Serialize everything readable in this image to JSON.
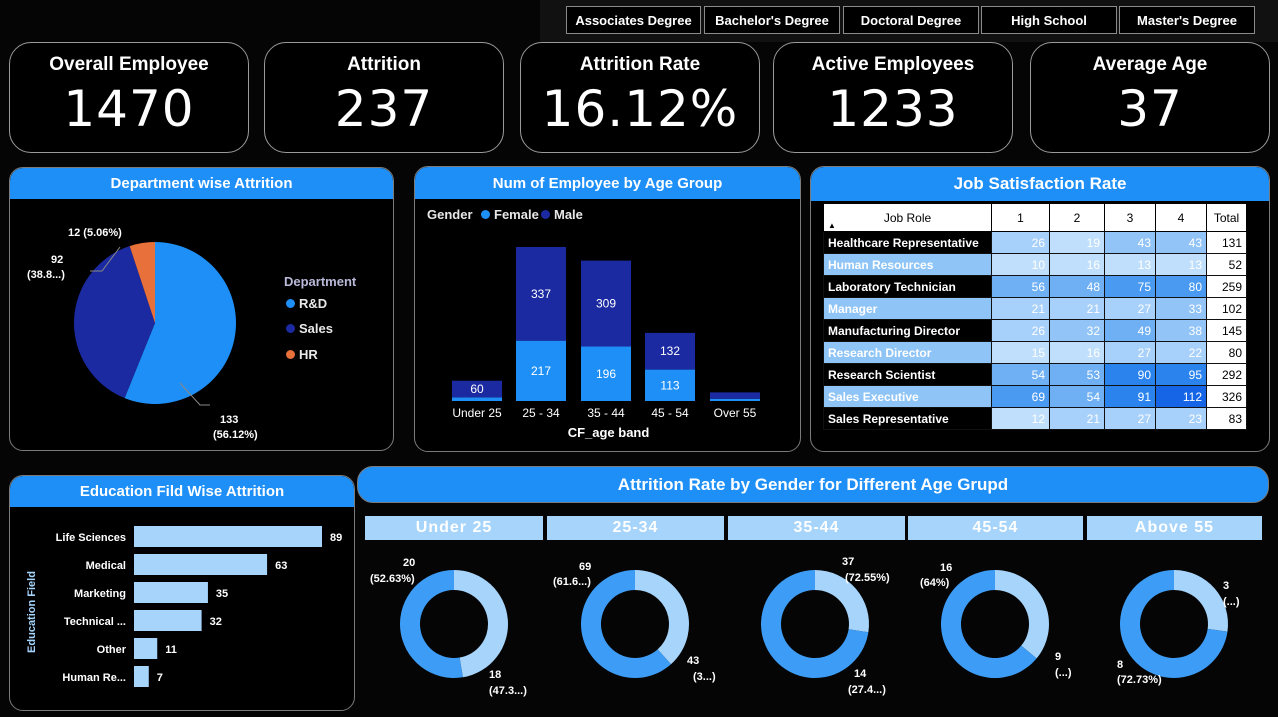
{
  "slicer": [
    "Associates Degree",
    "Bachelor's Degree",
    "Doctoral Degree",
    "High School",
    "Master's Degree"
  ],
  "kpis": [
    {
      "label": "Overall Employee",
      "value": "1470"
    },
    {
      "label": "Attrition",
      "value": "237"
    },
    {
      "label": "Attrition Rate",
      "value": "16.12%"
    },
    {
      "label": "Active Employees",
      "value": "1233"
    },
    {
      "label": "Average Age",
      "value": "37"
    }
  ],
  "colors": {
    "accent": "#1e8ff7",
    "rnd": "#1e8ff7",
    "sales": "#1b2aa0",
    "hr": "#e8703a",
    "light": "#a6d4fb"
  },
  "dept": {
    "title": "Department wise Attrition",
    "legend_title": "Department",
    "legend": [
      "R&D",
      "Sales",
      "HR"
    ],
    "labels": {
      "rnd_value": "133",
      "rnd_pct": "(56.12%)",
      "sales_value": "92",
      "sales_pct": "(38.8...)",
      "hr": "12 (5.06%)"
    }
  },
  "age": {
    "title": "Num of Employee by Age Group",
    "legend_title": "Gender",
    "legend": [
      "Female",
      "Male"
    ],
    "xlabel": "CF_age band"
  },
  "job": {
    "title": "Job Satisfaction Rate",
    "headers": [
      "Job Role",
      "1",
      "2",
      "3",
      "4",
      "Total"
    ],
    "rows": [
      {
        "role": "Healthcare Representative",
        "v": [
          "26",
          "19",
          "43",
          "43"
        ],
        "total": "131"
      },
      {
        "role": "Human Resources",
        "v": [
          "10",
          "16",
          "13",
          "13"
        ],
        "total": "52"
      },
      {
        "role": "Laboratory Technician",
        "v": [
          "56",
          "48",
          "75",
          "80"
        ],
        "total": "259"
      },
      {
        "role": "Manager",
        "v": [
          "21",
          "21",
          "27",
          "33"
        ],
        "total": "102"
      },
      {
        "role": "Manufacturing Director",
        "v": [
          "26",
          "32",
          "49",
          "38"
        ],
        "total": "145"
      },
      {
        "role": "Research Director",
        "v": [
          "15",
          "16",
          "27",
          "22"
        ],
        "total": "80"
      },
      {
        "role": "Research Scientist",
        "v": [
          "54",
          "53",
          "90",
          "95"
        ],
        "total": "292"
      },
      {
        "role": "Sales Executive",
        "v": [
          "69",
          "54",
          "91",
          "112"
        ],
        "total": "326"
      },
      {
        "role": "Sales Representative",
        "v": [
          "12",
          "21",
          "27",
          "23"
        ],
        "total": "83"
      }
    ]
  },
  "edu": {
    "title": "Education Fild Wise Attrition",
    "ylabel": "Education Field"
  },
  "gender": {
    "title": "Attrition Rate by Gender for Different Age Grupd",
    "groups": [
      {
        "label": "Under 25",
        "dark_value": "20",
        "dark_pct": "(52.63%)",
        "light_value": "18",
        "light_pct": "(47.3...)"
      },
      {
        "label": "25-34",
        "dark_value": "69",
        "dark_pct": "(61.6...)",
        "light_value": "43",
        "light_pct": "(3...)"
      },
      {
        "label": "35-44",
        "dark_value": "37",
        "dark_pct": "(72.55%)",
        "light_value": "14",
        "light_pct": "(27.4...)"
      },
      {
        "label": "45-54",
        "dark_value": "16",
        "dark_pct": "(64%)",
        "light_value": "9",
        "light_pct": "(...)"
      },
      {
        "label": "Above 55",
        "dark_value": "8",
        "dark_pct": "(72.73%)",
        "light_value": "3",
        "light_pct": "(...)"
      }
    ]
  },
  "chart_data": [
    {
      "type": "pie",
      "title": "Department wise Attrition",
      "categories": [
        "R&D",
        "Sales",
        "HR"
      ],
      "values": [
        133,
        92,
        12
      ]
    },
    {
      "type": "bar",
      "title": "Num of Employee by Age Group",
      "stacked": true,
      "categories": [
        "Under 25",
        "25 - 34",
        "35 - 44",
        "45 - 54",
        "Over 55"
      ],
      "series": [
        {
          "name": "Female",
          "values": [
            13,
            217,
            196,
            113,
            8
          ]
        },
        {
          "name": "Male",
          "values": [
            60,
            337,
            309,
            132,
            23
          ]
        }
      ],
      "value_labels": {
        "Female": [
          "",
          "217",
          "196",
          "113",
          ""
        ],
        "Male": [
          "60",
          "337",
          "309",
          "132",
          ""
        ]
      },
      "xlabel": "CF_age band",
      "ylim": [
        0,
        560
      ]
    },
    {
      "type": "bar",
      "orientation": "horizontal",
      "title": "Education Fild Wise Attrition",
      "categories": [
        "Life Sciences",
        "Medical",
        "Marketing",
        "Technical ...",
        "Other",
        "Human Re..."
      ],
      "values": [
        89,
        63,
        35,
        32,
        11,
        7
      ],
      "ylabel": "Education Field",
      "xlim": [
        0,
        89
      ]
    },
    {
      "type": "pie",
      "title": "Attrition Rate by Gender for Different Age Grupd",
      "donut": true,
      "groups": [
        "Under 25",
        "25-34",
        "35-44",
        "45-54",
        "Above 55"
      ],
      "series": [
        {
          "values": [
            20,
            69,
            37,
            16,
            8
          ]
        },
        {
          "values": [
            18,
            43,
            14,
            9,
            3
          ]
        }
      ]
    }
  ]
}
